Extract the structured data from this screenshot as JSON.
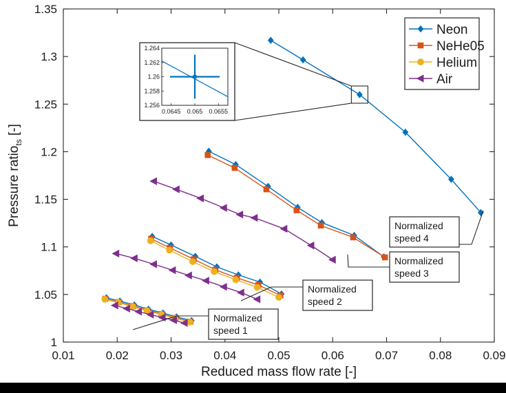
{
  "chart_data": {
    "type": "line",
    "title": "",
    "xlabel": "Reduced mass flow rate [-]",
    "ylabel": "Pressure ratio",
    "ylabel_sub": "ts",
    "ylabel_unit": " [-]",
    "xlim": [
      0.01,
      0.09
    ],
    "ylim": [
      1.0,
      1.35
    ],
    "xticks": [
      "0.01",
      "0.02",
      "0.03",
      "0.04",
      "0.05",
      "0.06",
      "0.07",
      "0.08",
      "0.09"
    ],
    "yticks": [
      "1",
      "1.05",
      "1.1",
      "1.15",
      "1.2",
      "1.25",
      "1.3",
      "1.35"
    ],
    "grid": false,
    "legend_position": "top-right",
    "legend": [
      {
        "name": "Neon",
        "color": "#0072BD",
        "marker": "diamond"
      },
      {
        "name": "NeHe05",
        "color": "#D95319",
        "marker": "square"
      },
      {
        "name": "Helium",
        "color": "#EDB120",
        "marker": "circle"
      },
      {
        "name": "Air",
        "color": "#7E2F8E",
        "marker": "left-triangle"
      }
    ],
    "series": [
      {
        "name": "Neon",
        "speed": "Normalized speed 4",
        "color": "#0072BD",
        "marker": "diamond",
        "x": [
          0.0485,
          0.0545,
          0.065,
          0.0735,
          0.082,
          0.0875
        ],
        "y": [
          1.317,
          1.2965,
          1.26,
          1.2205,
          1.171,
          1.136
        ]
      },
      {
        "name": "Neon",
        "speed": "Normalized speed 3",
        "color": "#0072BD",
        "marker": "diamond",
        "x": [
          0.037,
          0.042,
          0.048,
          0.0535,
          0.058,
          0.064,
          0.0695
        ],
        "y": [
          1.2005,
          1.1865,
          1.1635,
          1.1415,
          1.1255,
          1.112,
          1.0895
        ]
      },
      {
        "name": "Neon",
        "speed": "Normalized speed 2",
        "color": "#0072BD",
        "marker": "diamond",
        "x": [
          0.0265,
          0.03,
          0.0345,
          0.0385,
          0.0425,
          0.0465,
          0.0505
        ],
        "y": [
          1.111,
          1.102,
          1.09,
          1.079,
          1.0705,
          1.063,
          1.0505
        ]
      },
      {
        "name": "Neon",
        "speed": "Normalized speed 1",
        "color": "#0072BD",
        "marker": "diamond",
        "x": [
          0.018,
          0.0205,
          0.0232,
          0.0258,
          0.0285,
          0.031,
          0.0338
        ],
        "y": [
          1.0465,
          1.043,
          1.039,
          1.0345,
          1.0305,
          1.0265,
          1.0225
        ]
      },
      {
        "name": "NeHe05",
        "speed": "Normalized speed 3",
        "color": "#D95319",
        "marker": "square",
        "x": [
          0.0368,
          0.0418,
          0.0477,
          0.0533,
          0.0578,
          0.0638,
          0.0697
        ],
        "y": [
          1.1965,
          1.183,
          1.1605,
          1.1385,
          1.1225,
          1.11,
          1.089
        ]
      },
      {
        "name": "NeHe05",
        "speed": "Normalized speed 2",
        "color": "#D95319",
        "marker": "square",
        "x": [
          0.0263,
          0.0298,
          0.0342,
          0.0382,
          0.0422,
          0.0462,
          0.0503
        ],
        "y": [
          1.1085,
          1.099,
          1.087,
          1.076,
          1.0675,
          1.06,
          1.049
        ]
      },
      {
        "name": "NeHe05",
        "speed": "Normalized speed 1",
        "color": "#D95319",
        "marker": "square",
        "x": [
          0.0178,
          0.0203,
          0.023,
          0.0256,
          0.0283,
          0.0308,
          0.0336
        ],
        "y": [
          1.0455,
          1.042,
          1.0378,
          1.0335,
          1.0295,
          1.0255,
          1.0215
        ]
      },
      {
        "name": "Helium",
        "speed": "Normalized speed 2",
        "color": "#EDB120",
        "marker": "circle",
        "x": [
          0.0262,
          0.0297,
          0.034,
          0.038,
          0.042,
          0.046,
          0.05
        ],
        "y": [
          1.1065,
          1.0965,
          1.0845,
          1.074,
          1.0655,
          1.0575,
          1.047
        ]
      },
      {
        "name": "Helium",
        "speed": "Normalized speed 1",
        "color": "#EDB120",
        "marker": "circle",
        "x": [
          0.0177,
          0.0202,
          0.0229,
          0.0255,
          0.0282,
          0.0307,
          0.0335
        ],
        "y": [
          1.045,
          1.0415,
          1.0372,
          1.033,
          1.029,
          1.025,
          1.021
        ]
      },
      {
        "name": "Air",
        "speed": "Normalized speed 3",
        "color": "#7E2F8E",
        "marker": "left-triangle",
        "x": [
          0.0268,
          0.031,
          0.0355,
          0.0398,
          0.0428,
          0.0455,
          0.051,
          0.056,
          0.06
        ],
        "y": [
          1.169,
          1.1605,
          1.151,
          1.141,
          1.134,
          1.1305,
          1.119,
          1.1015,
          1.0865
        ]
      },
      {
        "name": "Air",
        "speed": "Normalized speed 2",
        "color": "#7E2F8E",
        "marker": "left-triangle",
        "x": [
          0.0198,
          0.0232,
          0.0268,
          0.0303,
          0.0333,
          0.0365,
          0.0398,
          0.043,
          0.046
        ],
        "y": [
          1.093,
          1.088,
          1.0818,
          1.0755,
          1.07,
          1.0645,
          1.058,
          1.052,
          1.045
        ]
      },
      {
        "name": "Air",
        "speed": "Normalized speed 1",
        "color": "#7E2F8E",
        "marker": "left-triangle",
        "x": [
          0.0196,
          0.0218,
          0.024,
          0.0262,
          0.0284,
          0.0305,
          0.0325
        ],
        "y": [
          1.0385,
          1.0352,
          1.032,
          1.0288,
          1.0258,
          1.023,
          1.02
        ]
      }
    ],
    "annotations": [
      {
        "id": "speed1",
        "label_line1": "Normalized",
        "label_line2": "speed 1"
      },
      {
        "id": "speed2",
        "label_line1": "Normalized",
        "label_line2": "speed 2"
      },
      {
        "id": "speed3",
        "label_line1": "Normalized",
        "label_line2": "speed 3"
      },
      {
        "id": "speed4",
        "label_line1": "Normalized",
        "label_line2": "speed 4"
      }
    ],
    "inset": {
      "xlim": [
        0.0643,
        0.0657
      ],
      "ylim": [
        1.256,
        1.264
      ],
      "xticks": [
        "0.0645",
        "0.065",
        "0.0655"
      ],
      "yticks": [
        "1.264",
        "1.262",
        "1.26",
        "1.258",
        "1.256"
      ],
      "point": {
        "x": 0.065,
        "y": 1.26
      },
      "series_color": "#0072BD",
      "source_point": {
        "x": 0.065,
        "y": 1.26
      }
    }
  }
}
